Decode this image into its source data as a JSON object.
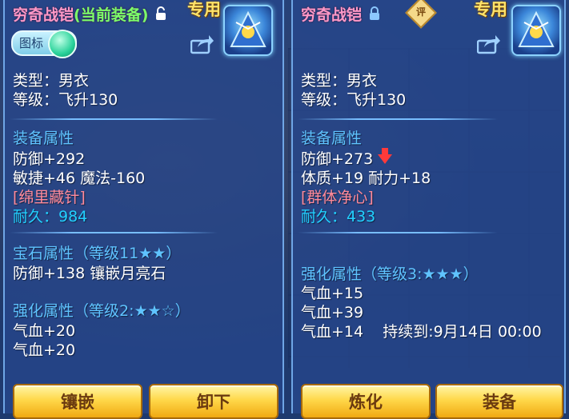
{
  "left": {
    "title": "穷奇战铠",
    "status": "(当前装备)",
    "exclusive": "专用",
    "toggle_label": "图标",
    "type_line": "类型：男衣",
    "level_line": "等级：飞升130",
    "equip_attr_heading": "装备属性",
    "attr_lines": [
      "防御+292",
      "敏捷+46 魔法-160"
    ],
    "special": "[绵里藏针]",
    "durability": "耐久：984",
    "gem_heading": "宝石属性（等级11★★）",
    "gem_line": "防御+138 镶嵌月亮石",
    "enhance_heading": "强化属性（等级2:★★☆）",
    "enhance_lines": [
      "气血+20",
      "气血+20"
    ],
    "buttons": {
      "inlay": "镶嵌",
      "unequip": "卸下"
    }
  },
  "right": {
    "title": "穷奇战铠",
    "badge": "评",
    "exclusive": "专用",
    "type_line": "类型：男衣",
    "level_line": "等级：飞升130",
    "equip_attr_heading": "装备属性",
    "defense_line": "防御+273",
    "attr_line2": "体质+19 耐力+18",
    "special": "[群体净心]",
    "durability": "耐久：433",
    "enhance_heading": "强化属性（等级3:★★★）",
    "enhance_lines": [
      "气血+15",
      "气血+39",
      "气血+14    持续到:9月14日 00:00"
    ],
    "buttons": {
      "refine": "炼化",
      "equip": "装备"
    }
  },
  "icons": [
    "lock-open-icon",
    "lock-closed-icon",
    "share-icon",
    "down-arrow-icon"
  ],
  "colors": {
    "title": "#ff99c8",
    "status": "#7dff6a",
    "section": "#5fc3ff",
    "special": "#ff8a9a",
    "durability": "#22d0ff",
    "exclusive": "#ffe36a"
  }
}
